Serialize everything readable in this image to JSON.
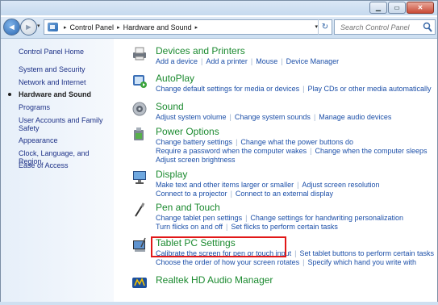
{
  "window": {
    "minimize_label": "▁",
    "maximize_label": "▭",
    "close_label": "✕"
  },
  "toolbar": {
    "back_label": "◄",
    "forward_label": "►",
    "recent_label": "▾",
    "breadcrumb": [
      "Control Panel",
      "Hardware and Sound"
    ],
    "crumb_separator": "▸",
    "address_dropdown": "▾",
    "refresh_label": "↻",
    "search_placeholder": "Search Control Panel"
  },
  "sidebar": {
    "items": [
      "Control Panel Home",
      "System and Security",
      "Network and Internet",
      "Hardware and Sound",
      "Programs",
      "User Accounts and Family Safety",
      "Appearance",
      "Clock, Language, and Region",
      "Ease of Access"
    ],
    "current_index": 3
  },
  "categories": [
    {
      "title": "Devices and Printers",
      "icon": "printer-icon",
      "lines": [
        [
          "Add a device",
          "Add a printer",
          "Mouse",
          "Device Manager"
        ]
      ]
    },
    {
      "title": "AutoPlay",
      "icon": "autoplay-icon",
      "lines": [
        [
          "Change default settings for media or devices",
          "Play CDs or other media automatically"
        ]
      ]
    },
    {
      "title": "Sound",
      "icon": "speaker-icon",
      "lines": [
        [
          "Adjust system volume",
          "Change system sounds",
          "Manage audio devices"
        ]
      ]
    },
    {
      "title": "Power Options",
      "icon": "battery-icon",
      "lines": [
        [
          "Change battery settings",
          "Change what the power buttons do"
        ],
        [
          "Require a password when the computer wakes",
          "Change when the computer sleeps"
        ],
        [
          "Adjust screen brightness"
        ]
      ]
    },
    {
      "title": "Display",
      "icon": "display-icon",
      "lines": [
        [
          "Make text and other items larger or smaller",
          "Adjust screen resolution"
        ],
        [
          "Connect to a projector",
          "Connect to an external display"
        ]
      ]
    },
    {
      "title": "Pen and Touch",
      "icon": "pen-icon",
      "lines": [
        [
          "Change tablet pen settings",
          "Change settings for handwriting personalization"
        ],
        [
          "Turn flicks on and off",
          "Set flicks to perform certain tasks"
        ]
      ]
    },
    {
      "title": "Tablet PC Settings",
      "icon": "tablet-icon",
      "lines": [
        [
          "Calibrate the screen for pen or touch input",
          "Set tablet buttons to perform certain tasks"
        ],
        [
          "Choose the order of how your screen rotates",
          "Specify which hand you write with"
        ]
      ]
    },
    {
      "title": "Realtek HD Audio Manager",
      "icon": "realtek-icon",
      "lines": []
    }
  ]
}
